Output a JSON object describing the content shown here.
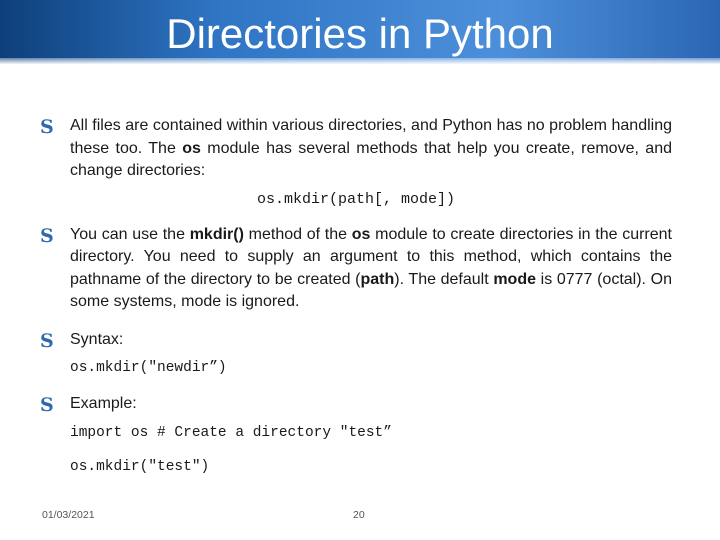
{
  "slide": {
    "title": "Directories in Python",
    "bullets": {
      "b1": {
        "text": "All files are contained within various directories, and Python has no problem handling these too. The ",
        "bold1": "os",
        "text2": " module has several methods that help you create, remove, and change directories:"
      },
      "code1": "os.mkdir(path[, mode])",
      "b2": {
        "t1": "You can use the ",
        "bold1": "mkdir()",
        "t2": " method of the ",
        "bold2": "os",
        "t3": " module to create directories in the current directory. You need to supply an argument to this method, which contains the pathname of the directory to be created (",
        "bold3": "path",
        "t4": "). The default ",
        "bold4": "mode",
        "t5": " is 0777 (octal). On some systems, mode is ignored."
      },
      "b3": "Syntax:",
      "code2": "os.mkdir(\"newdir”)",
      "b4": "Example:",
      "code3": "import os # Create a directory \"test”",
      "code4": "os.mkdir(\"test\")"
    },
    "footer": {
      "date": "01/03/2021",
      "page": "20"
    },
    "bullet_glyph": "S",
    "colors": {
      "header_dark": "#0d3f7a",
      "header_light": "#4d8fda",
      "bullet": "#2e68b0"
    }
  }
}
